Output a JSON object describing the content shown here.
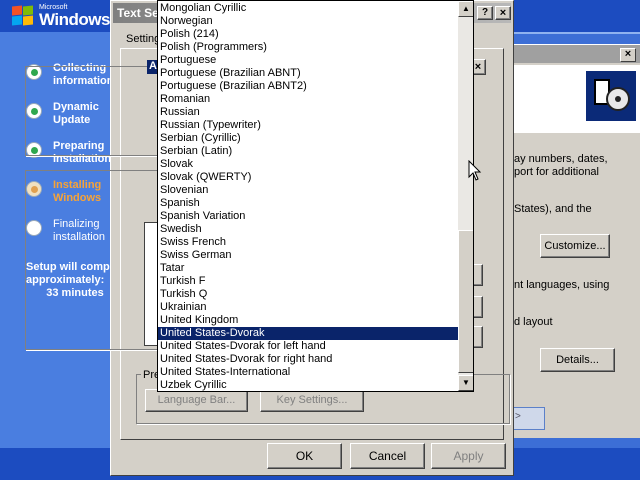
{
  "setup": {
    "logo_small": "Microsoft",
    "logo_main": "Windows",
    "steps": [
      {
        "label": "Collecting information",
        "state": "done"
      },
      {
        "label": "Dynamic Update",
        "state": "done"
      },
      {
        "label": "Preparing installation",
        "state": "done"
      },
      {
        "label": "Installing Windows",
        "state": "current"
      },
      {
        "label": "Finalizing installation",
        "state": "pending"
      }
    ],
    "eta_line1": "Setup will comp",
    "eta_line2": "approximately:",
    "eta_minutes": "33 minutes"
  },
  "back_dialog": {
    "close": "×",
    "text_lines": [
      "ay numbers, dates,",
      "port for additional",
      "States), and the",
      "nt languages, using",
      "d layout"
    ],
    "customize_label": "Customize...",
    "details_label": "Details..."
  },
  "text_services": {
    "title": "Text Se",
    "help": "?",
    "close": "×",
    "tab_label": "Setting",
    "groupbox_pref_label": "Pre",
    "groupbox_top_title": "A",
    "x_button": "×",
    "language_bar_label": "Language Bar...",
    "key_settings_label": "Key Settings...",
    "ok_label": "OK",
    "cancel_label": "Cancel",
    "apply_label": "Apply"
  },
  "dropdown": {
    "selected_index": 25,
    "items": [
      "Mongolian Cyrillic",
      "Norwegian",
      "Polish (214)",
      "Polish (Programmers)",
      "Portuguese",
      "Portuguese (Brazilian ABNT)",
      "Portuguese (Brazilian ABNT2)",
      "Romanian",
      "Russian",
      "Russian (Typewriter)",
      "Serbian (Cyrillic)",
      "Serbian (Latin)",
      "Slovak",
      "Slovak (QWERTY)",
      "Slovenian",
      "Spanish",
      "Spanish Variation",
      "Swedish",
      "Swiss French",
      "Swiss German",
      "Tatar",
      "Turkish F",
      "Turkish Q",
      "Ukrainian",
      "United Kingdom",
      "United States-Dvorak",
      "United States-Dvorak for left hand",
      "United States-Dvorak for right hand",
      "United States-International",
      "Uzbek Cyrillic"
    ],
    "scroll_up": "▲",
    "scroll_down": "▼"
  },
  "colors": {
    "selection": "#0a246a",
    "setup_blue": "#3c6ed6",
    "current_step": "#f7a337"
  }
}
